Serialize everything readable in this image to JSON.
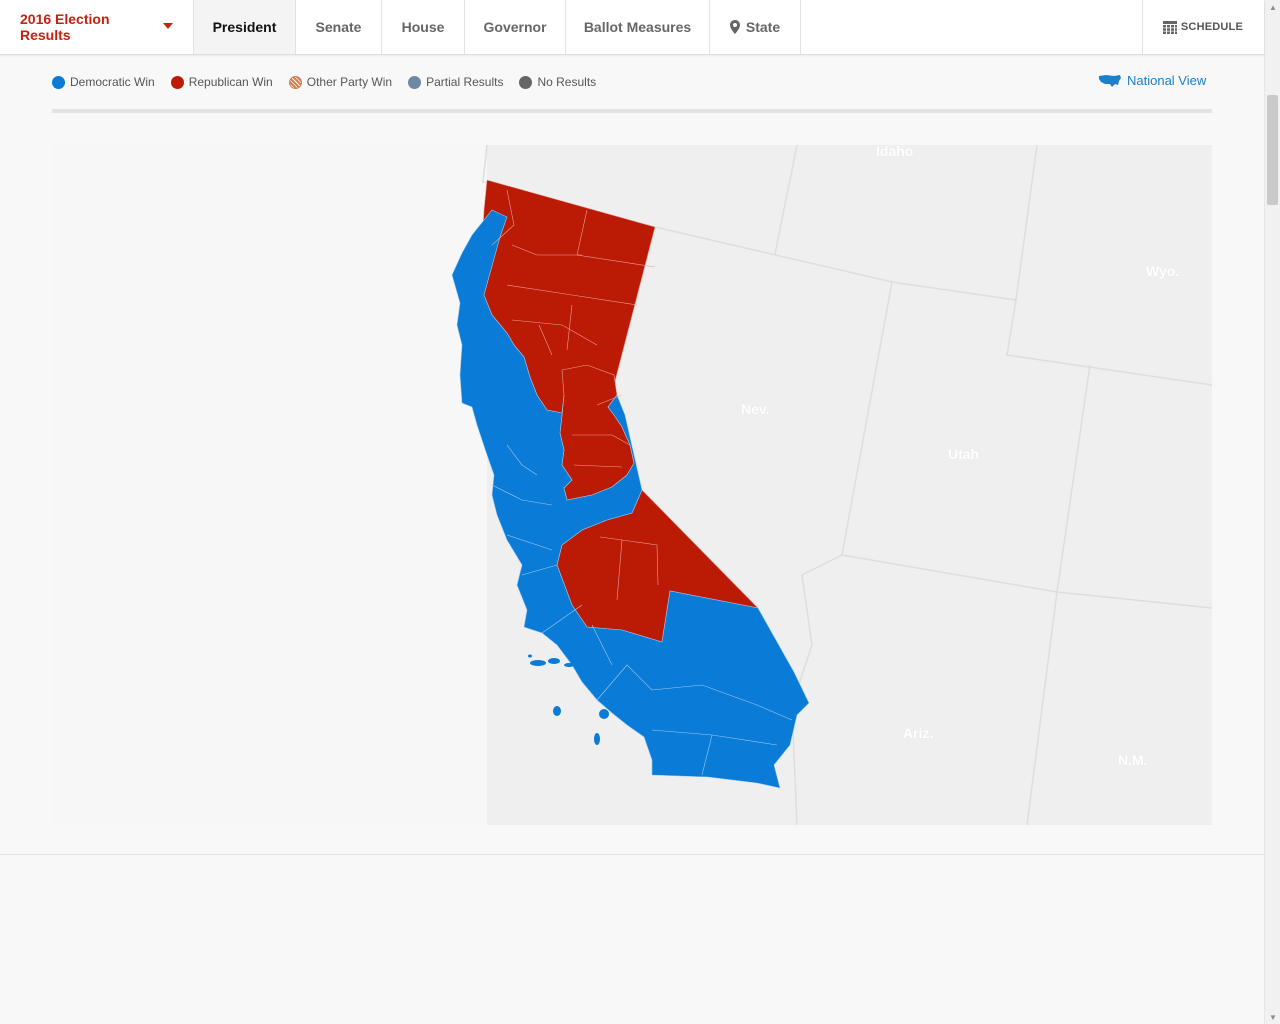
{
  "nav": {
    "brand": "2016 Election Results",
    "tabs": [
      "President",
      "Senate",
      "House",
      "Governor",
      "Ballot Measures",
      "State"
    ],
    "active_tab": "President",
    "schedule": "SCHEDULE"
  },
  "legend": {
    "items": [
      "Democratic Win",
      "Republican Win",
      "Other Party Win",
      "Partial Results",
      "No Results"
    ],
    "national_view": "National View"
  },
  "colors": {
    "democratic": "#0a7bd6",
    "republican": "#bb1a04",
    "other": "#d97a4f",
    "partial": "#6d87a4",
    "none": "#666666",
    "accent": "#c4210f"
  },
  "map": {
    "state": "California",
    "neighbor_labels": [
      "Idaho",
      "Wyo.",
      "Nev.",
      "Utah",
      "Ariz.",
      "N.M."
    ]
  }
}
